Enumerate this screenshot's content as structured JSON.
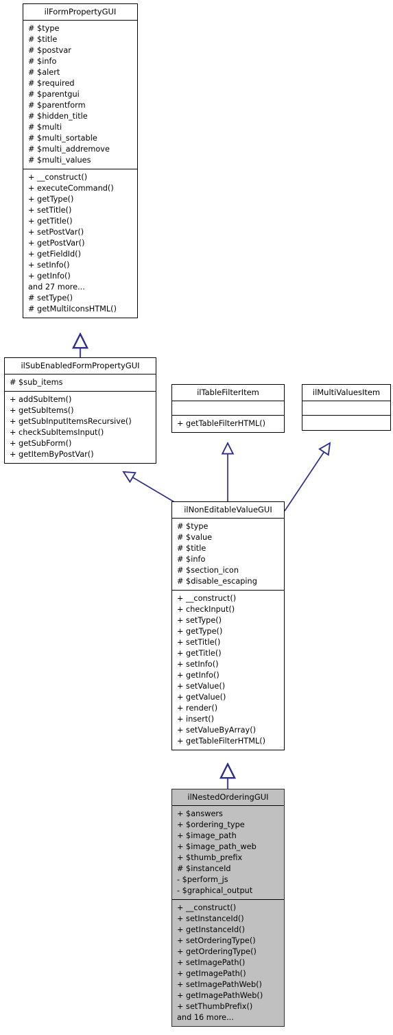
{
  "diagram": {
    "kind": "uml-class-inheritance-diagram",
    "background_color": "#ffffff",
    "edge_color": "#2e2e8f",
    "highlight_fill": "#c0c0c0",
    "border_color": "#000000"
  },
  "classes": [
    {
      "id": "ilFormPropertyGUI",
      "name": "ilFormPropertyGUI",
      "highlighted": false,
      "attributes": [
        "#  $type",
        "#  $title",
        "#  $postvar",
        "#  $info",
        "#  $alert",
        "#  $required",
        "#  $parentgui",
        "#  $parentform",
        "#  $hidden_title",
        "#  $multi",
        "#  $multi_sortable",
        "#  $multi_addremove",
        "#  $multi_values"
      ],
      "methods": [
        "+  __construct()",
        "+  executeCommand()",
        "+  getType()",
        "+  setTitle()",
        "+  getTitle()",
        "+  setPostVar()",
        "+  getPostVar()",
        "+  getFieldId()",
        "+  setInfo()",
        "+  getInfo()",
        "and 27 more...",
        "#  setType()",
        "#  getMultiIconsHTML()"
      ]
    },
    {
      "id": "ilSubEnabledFormPropertyGUI",
      "name": "ilSubEnabledFormPropertyGUI",
      "highlighted": false,
      "attributes": [
        "#  $sub_items"
      ],
      "methods": [
        "+  addSubItem()",
        "+  getSubItems()",
        "+  getSubInputItemsRecursive()",
        "+  checkSubItemsInput()",
        "+  getSubForm()",
        "+  getItemByPostVar()"
      ]
    },
    {
      "id": "ilTableFilterItem",
      "name": "ilTableFilterItem",
      "highlighted": false,
      "attributes": [],
      "methods": [
        "+  getTableFilterHTML()"
      ]
    },
    {
      "id": "ilMultiValuesItem",
      "name": "ilMultiValuesItem",
      "highlighted": false,
      "attributes": [],
      "methods": []
    },
    {
      "id": "ilNonEditableValueGUI",
      "name": "ilNonEditableValueGUI",
      "highlighted": false,
      "attributes": [
        "#  $type",
        "#  $value",
        "#  $title",
        "#  $info",
        "#  $section_icon",
        "#  $disable_escaping"
      ],
      "methods": [
        "+  __construct()",
        "+  checkInput()",
        "+  setType()",
        "+  getType()",
        "+  setTitle()",
        "+  getTitle()",
        "+  setInfo()",
        "+  getInfo()",
        "+  setValue()",
        "+  getValue()",
        "+  render()",
        "+  insert()",
        "+  setValueByArray()",
        "+  getTableFilterHTML()"
      ]
    },
    {
      "id": "ilNestedOrderingGUI",
      "name": "ilNestedOrderingGUI",
      "highlighted": true,
      "attributes": [
        "+  $answers",
        "+  $ordering_type",
        "+  $image_path",
        "+  $image_path_web",
        "+  $thumb_prefix",
        "#  $instanceId",
        "-  $perform_js",
        "-  $graphical_output"
      ],
      "methods": [
        "+  __construct()",
        "+  setInstanceId()",
        "+  getInstanceId()",
        "+  setOrderingType()",
        "+  getOrderingType()",
        "+  setImagePath()",
        "+  getImagePath()",
        "+  setImagePathWeb()",
        "+  getImagePathWeb()",
        "+  setThumbPrefix()",
        "and 16 more..."
      ]
    }
  ],
  "relations": [
    {
      "from": "ilSubEnabledFormPropertyGUI",
      "to": "ilFormPropertyGUI",
      "type": "inheritance"
    },
    {
      "from": "ilNonEditableValueGUI",
      "to": "ilSubEnabledFormPropertyGUI",
      "type": "inheritance"
    },
    {
      "from": "ilNonEditableValueGUI",
      "to": "ilTableFilterItem",
      "type": "inheritance"
    },
    {
      "from": "ilNonEditableValueGUI",
      "to": "ilMultiValuesItem",
      "type": "inheritance"
    },
    {
      "from": "ilNestedOrderingGUI",
      "to": "ilNonEditableValueGUI",
      "type": "inheritance"
    }
  ]
}
